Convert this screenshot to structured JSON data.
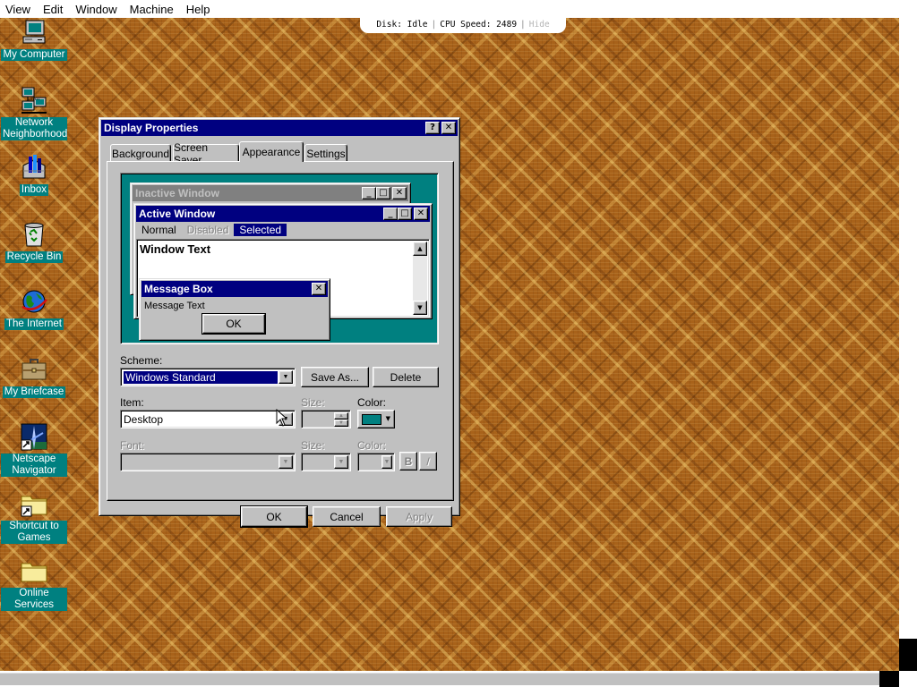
{
  "host_menu": [
    "View",
    "Edit",
    "Window",
    "Machine",
    "Help"
  ],
  "status": {
    "disk": "Disk: Idle",
    "cpu": "CPU Speed: 2489",
    "hide": "Hide",
    "separator": "|"
  },
  "desktop_icons": [
    {
      "label": "My Computer",
      "icon": "my-computer-icon"
    },
    {
      "label": "Network Neighborhood",
      "icon": "network-neighborhood-icon"
    },
    {
      "label": "Inbox",
      "icon": "inbox-icon"
    },
    {
      "label": "Recycle Bin",
      "icon": "recycle-bin-icon"
    },
    {
      "label": "The Internet",
      "icon": "internet-icon"
    },
    {
      "label": "My Briefcase",
      "icon": "briefcase-icon"
    },
    {
      "label": "Netscape Navigator",
      "icon": "netscape-icon"
    },
    {
      "label": "Shortcut to Games",
      "icon": "folder-shortcut-icon"
    },
    {
      "label": "Online Services",
      "icon": "folder-icon"
    }
  ],
  "dialog": {
    "title": "Display Properties",
    "help_glyph": "?",
    "close_glyph": "✕",
    "tabs": [
      "Background",
      "Screen Saver",
      "Appearance",
      "Settings"
    ],
    "active_tab": "Appearance",
    "preview": {
      "inactive_title": "Inactive Window",
      "active_title": "Active Window",
      "menu_normal": "Normal",
      "menu_disabled": "Disabled",
      "menu_selected": "Selected",
      "window_text": "Window Text",
      "msgbox_title": "Message Box",
      "msgbox_text": "Message Text",
      "msgbox_ok": "OK",
      "min_glyph": "_",
      "max_glyph": "□",
      "close_glyph": "✕"
    },
    "scheme_label": "Scheme:",
    "scheme_value": "Windows Standard",
    "save_as": "Save As...",
    "delete": "Delete",
    "item_label": "Item:",
    "item_value": "Desktop",
    "size_label": "Size:",
    "color_label": "Color:",
    "item_color": "#008080",
    "font_label": "Font:",
    "font_size_label": "Size:",
    "font_color_label": "Color:",
    "bold": "B",
    "italic": "/",
    "ok": "OK",
    "cancel": "Cancel",
    "apply": "Apply"
  },
  "colors": {
    "desktop_teal": "#008080",
    "title_active": "#000080",
    "title_inactive": "#808080",
    "face": "#c0c0c0"
  }
}
